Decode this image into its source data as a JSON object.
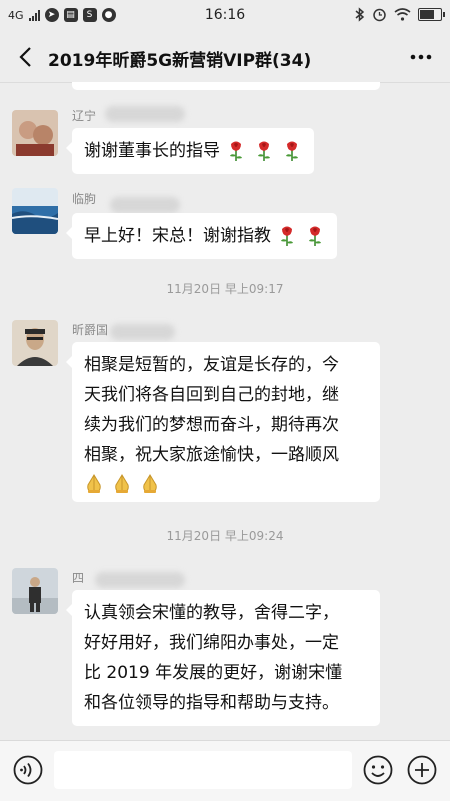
{
  "status_bar": {
    "network": "4G",
    "time": "16:16",
    "left_icons": [
      "telegram-icon",
      "storage-icon",
      "s-icon",
      "wechat-icon"
    ],
    "right_icons": [
      "bluetooth-icon",
      "alarm-icon",
      "wifi-icon",
      "battery-icon"
    ],
    "battery_level": 0.75
  },
  "title_bar": {
    "title": "2019年昕爵5G新营销VIP群(34)",
    "back_icon": "chevron-left-icon",
    "more_icon": "more-dots-icon"
  },
  "messages": [
    {
      "sender": "辽宁",
      "text": "谢谢董事长的指导",
      "emoji": [
        "rose",
        "rose",
        "rose"
      ],
      "avatar_colors": [
        "#c7a48a",
        "#8b3a2e"
      ]
    },
    {
      "sender": "临朐",
      "text": "早上好！宋总！谢谢指教",
      "emoji": [
        "rose",
        "rose"
      ],
      "avatar_colors": [
        "#2f6fa8",
        "#dfe9f1"
      ]
    },
    {
      "sender": "昕爵国",
      "text_lines": [
        "相聚是短暂的，友谊是长存的，今",
        "天我们将各自回到自己的封地，继",
        "续为我们的梦想而奋斗，期待再次",
        "相聚，祝大家旅途愉快，一路顺风"
      ],
      "emoji": [
        "folded-hands",
        "folded-hands",
        "folded-hands"
      ],
      "avatar_colors": [
        "#3a3a3a",
        "#d8c2a8"
      ]
    },
    {
      "sender": "四",
      "text_lines": [
        "认真领会宋懂的教导，舍得二字，",
        "好好用好，我们绵阳办事处，一定",
        "比 2019 年发展的更好，谢谢宋懂",
        "和各位领导的指导和帮助与支持。"
      ],
      "avatar_colors": [
        "#cfd6dc",
        "#3b3b3b"
      ]
    }
  ],
  "timestamps": [
    "11月20日 早上09:17",
    "11月20日 早上09:24"
  ],
  "input_bar": {
    "voice_icon": "voice-icon",
    "emoji_icon": "emoji-face-icon",
    "plus_icon": "plus-circle-icon",
    "input_value": ""
  }
}
